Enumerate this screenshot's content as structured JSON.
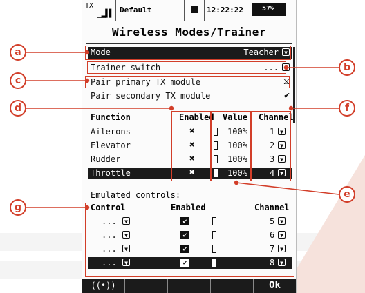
{
  "status": {
    "tx_label": "TX",
    "model_name": "Default",
    "time": "12:22:22",
    "battery": "57%"
  },
  "title": "Wireless Modes/Trainer",
  "settings": [
    {
      "label": "Mode",
      "value": "Teacher"
    },
    {
      "label": "Trainer switch",
      "value": "..."
    },
    {
      "label": "Pair primary TX module",
      "value": "⧖"
    },
    {
      "label": "Pair secondary TX module",
      "value": "✔"
    }
  ],
  "function_table": {
    "headers": [
      "Function",
      "Enabled",
      "Value",
      "Channel"
    ],
    "rows": [
      {
        "function": "Ailerons",
        "enabled": "✖",
        "value": "100%",
        "channel": "1"
      },
      {
        "function": "Elevator",
        "enabled": "✖",
        "value": "100%",
        "channel": "2"
      },
      {
        "function": "Rudder",
        "enabled": "✖",
        "value": "100%",
        "channel": "3"
      },
      {
        "function": "Throttle",
        "enabled": "✖",
        "value": "100%",
        "channel": "4"
      }
    ]
  },
  "emulated": {
    "title": "Emulated controls:",
    "headers": [
      "Control",
      "Enabled",
      "Channel"
    ],
    "rows": [
      {
        "control": "...",
        "enabled": "✔",
        "channel": "5"
      },
      {
        "control": "...",
        "enabled": "✔",
        "channel": "6"
      },
      {
        "control": "...",
        "enabled": "✔",
        "channel": "7"
      },
      {
        "control": "...",
        "enabled": "✔",
        "channel": "8"
      }
    ]
  },
  "softkeys": {
    "k1": "((•))",
    "k5": "Ok"
  },
  "callouts": {
    "a": "a",
    "b": "b",
    "c": "c",
    "d": "d",
    "e": "e",
    "f": "f",
    "g": "g"
  },
  "colors": {
    "accent": "#d23e29",
    "highlight": "#1b1b1b"
  }
}
